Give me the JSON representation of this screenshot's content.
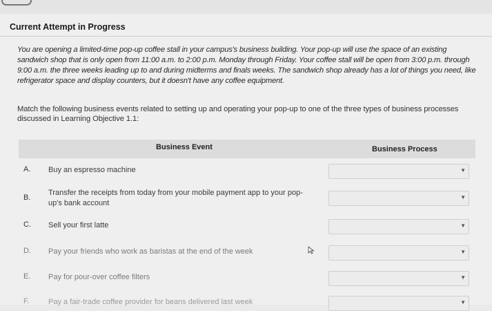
{
  "attempt": {
    "heading": "Current Attempt in Progress"
  },
  "scenario": "You are opening a limited-time pop-up coffee stall in your campus's business building. Your pop-up will use the space of an existing sandwich shop that is only open from 11:00 a.m. to 2:00 p.m. Monday through Friday. Your coffee stall will be open from 3:00 p.m. through 9:00 a.m. the three weeks leading up to and during midterms and finals weeks. The sandwich shop already has a lot of things you need, like refrigerator space and display counters, but it doesn't have any coffee equipment.",
  "instructions": "Match the following business events related to setting up and operating your pop-up to one of the three types of business processes discussed in Learning Objective 1.1:",
  "table": {
    "headers": {
      "event": "Business Event",
      "process": "Business Process"
    },
    "rows": [
      {
        "letter": "A.",
        "event": "Buy an espresso machine",
        "selected": ""
      },
      {
        "letter": "B.",
        "event": "Transfer the receipts from today from your mobile payment app to your pop-up's bank account",
        "selected": ""
      },
      {
        "letter": "C.",
        "event": "Sell your first latte",
        "selected": ""
      },
      {
        "letter": "D.",
        "event": "Pay your friends who work as baristas at the end of the week",
        "selected": ""
      },
      {
        "letter": "E.",
        "event": "Pay for pour-over coffee filters",
        "selected": ""
      },
      {
        "letter": "F.",
        "event": "Pay a fair-trade coffee provider for beans delivered last week",
        "selected": ""
      }
    ]
  },
  "icons": {
    "dropdown": "chevron-down-icon",
    "cursor": "mouse-pointer-icon"
  }
}
